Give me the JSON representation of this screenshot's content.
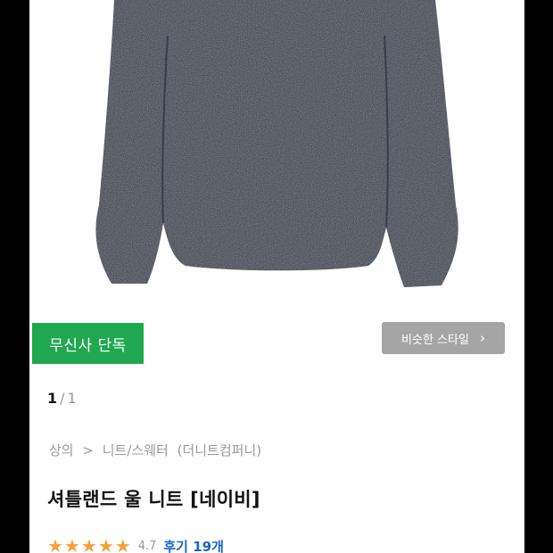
{
  "product": {
    "badge": "무신사 단독",
    "similar_style_label": "비슷한 스타일",
    "similar_style_chevron": "›",
    "pager": {
      "current": "1",
      "separator": "/",
      "total": "1"
    },
    "breadcrumb": [
      "상의",
      ">",
      "니트/스웨터",
      "(더니트컴퍼니)"
    ],
    "title": "셔틀랜드 울 니트 [네이비]",
    "rating": {
      "score": "4.7",
      "stars": 4.7,
      "review_label": "후기 19개"
    }
  },
  "colors": {
    "badge_bg": "#1fa84f",
    "similar_button_bg": "#a5a5a5",
    "sweater": "#2b3646",
    "star": "#f2a13b",
    "review_link": "#1a64c8"
  }
}
